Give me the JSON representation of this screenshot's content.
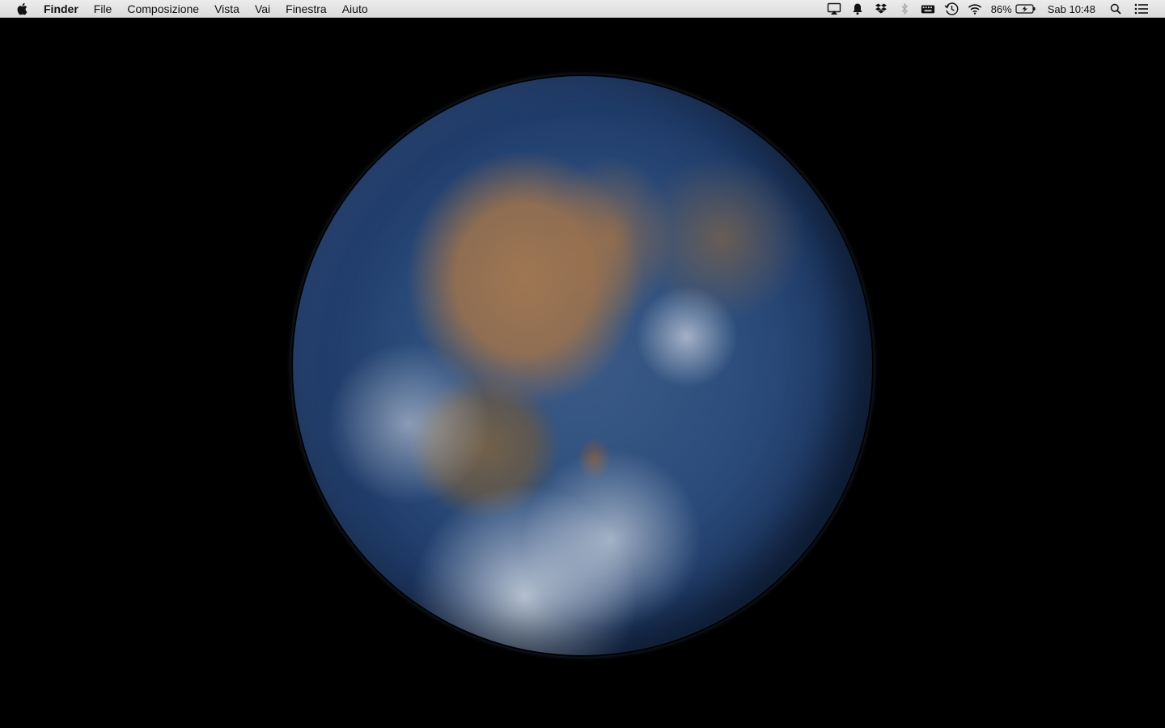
{
  "menubar": {
    "apple_icon": "apple-logo-icon",
    "app_name": "Finder",
    "menus": [
      "File",
      "Composizione",
      "Vista",
      "Vai",
      "Finestra",
      "Aiuto"
    ],
    "status_icons": [
      "airplay-icon",
      "notifications-bell-icon",
      "dropbox-icon",
      "bluetooth-icon",
      "keyboard-icon",
      "time-machine-icon",
      "wifi-icon"
    ],
    "battery_percent": "86%",
    "battery_icon": "battery-charging-icon",
    "clock": "Sab 10:48",
    "search_icon": "spotlight-search-icon",
    "notification_center_icon": "notification-center-list-icon"
  },
  "desktop": {
    "wallpaper": "earth-from-space"
  }
}
